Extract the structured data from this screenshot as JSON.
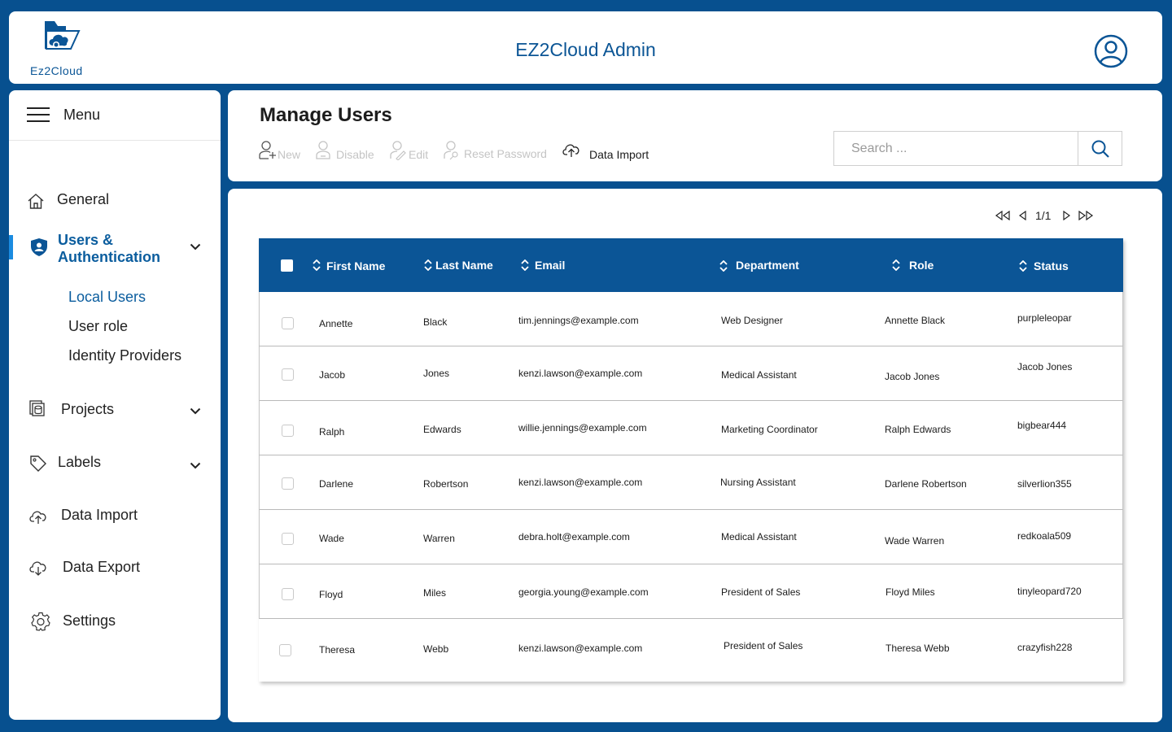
{
  "header": {
    "logo_text": "Ez2Cloud",
    "title": "EZ2Cloud Admin",
    "avatar_icon": "user-circle-icon"
  },
  "colors": {
    "brand": "#07508f",
    "header_row": "#0b5596",
    "accent_bar": "#1a8be0",
    "active_link": "#0b5d9e"
  },
  "sidebar": {
    "menu_label": "Menu",
    "items": [
      {
        "label": "General",
        "icon": "home-icon"
      },
      {
        "label": "Users &",
        "label2": "Authentication",
        "icon": "shield-user-icon",
        "active": true
      },
      {
        "label": "Projects",
        "icon": "folder-stack-icon"
      },
      {
        "label": "Labels",
        "icon": "tag-icon"
      },
      {
        "label": "Data Import",
        "icon": "cloud-upload-icon"
      },
      {
        "label": "Data Export",
        "icon": "cloud-download-icon"
      },
      {
        "label": "Settings",
        "icon": "gear-icon"
      }
    ],
    "sub_items": [
      {
        "label": "Local Users",
        "active": true
      },
      {
        "label": "User role"
      },
      {
        "label": "Identity Providers"
      }
    ]
  },
  "toolbar": {
    "page_title": "Manage Users",
    "actions": [
      {
        "label": "New",
        "icon": "user-add-icon",
        "enabled": false
      },
      {
        "label": "Disable",
        "icon": "user-disable-icon",
        "enabled": false
      },
      {
        "label": "Edit",
        "icon": "user-edit-icon",
        "enabled": false
      },
      {
        "label": "Reset Password",
        "icon": "user-key-icon",
        "enabled": false
      },
      {
        "label": "Data Import",
        "icon": "cloud-upload-icon",
        "enabled": true
      }
    ],
    "search_placeholder": "Search ...",
    "search_value": ""
  },
  "pagination": {
    "page_text": "1/1"
  },
  "table": {
    "columns": [
      "First Name",
      "Last Name",
      "Email",
      "Department",
      "Role",
      "Status"
    ],
    "rows": [
      {
        "first": "Annette",
        "last": "Black",
        "email": "tim.jennings@example.com",
        "dept": "Web Designer",
        "role": "Annette Black",
        "status": "purpleleopar"
      },
      {
        "first": "Jacob",
        "last": "Jones",
        "email": "kenzi.lawson@example.com",
        "dept": "Medical Assistant",
        "role": "Jacob Jones",
        "status": "Jacob Jones"
      },
      {
        "first": "Ralph",
        "last": "Edwards",
        "email": "willie.jennings@example.com",
        "dept": "Marketing Coordinator",
        "role": "Ralph Edwards",
        "status": "bigbear444"
      },
      {
        "first": "Darlene",
        "last": "Robertson",
        "email": "kenzi.lawson@example.com",
        "dept": "Nursing Assistant",
        "role": "Darlene Robertson",
        "status": "silverlion355"
      },
      {
        "first": "Wade",
        "last": "Warren",
        "email": "debra.holt@example.com",
        "dept": "Medical Assistant",
        "role": "Wade Warren",
        "status": "redkoala509"
      },
      {
        "first": "Floyd",
        "last": "Miles",
        "email": "georgia.young@example.com",
        "dept": "President of Sales",
        "role": "Floyd Miles",
        "status": "tinyleopard720"
      },
      {
        "first": "Theresa",
        "last": "Webb",
        "email": "kenzi.lawson@example.com",
        "dept": "President of Sales",
        "role": "Theresa Webb",
        "status": "crazyfish228"
      }
    ]
  }
}
